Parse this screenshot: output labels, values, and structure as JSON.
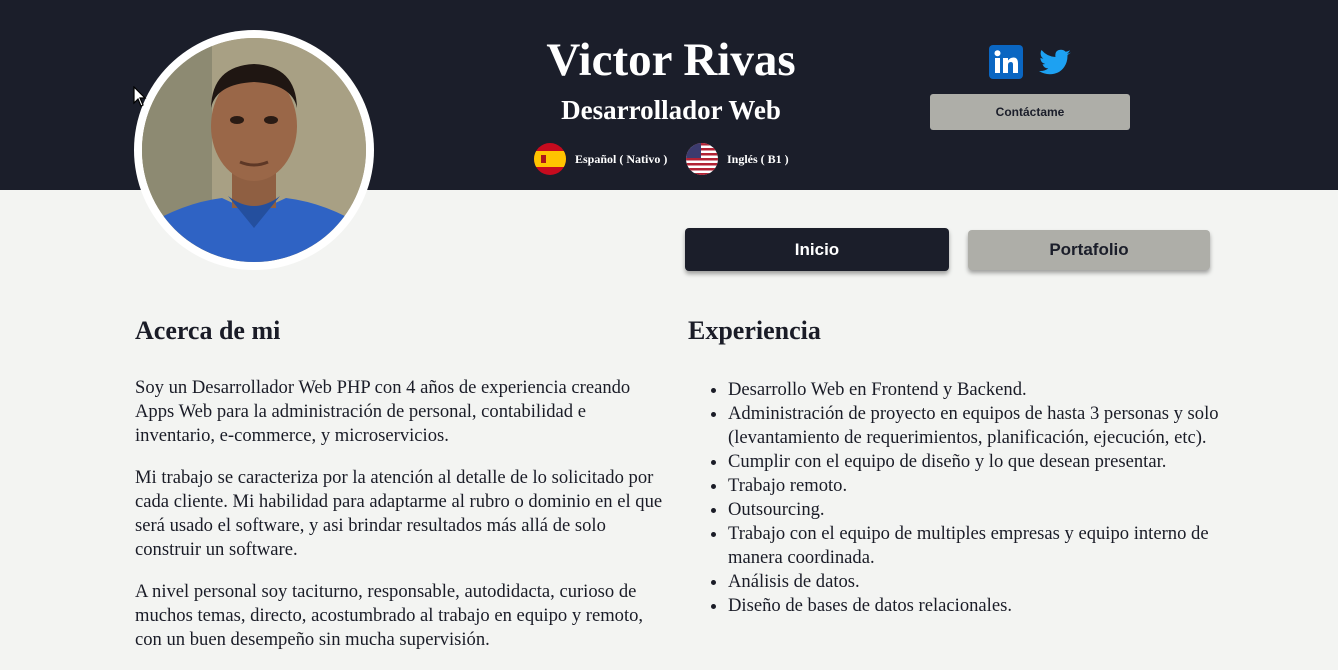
{
  "profile": {
    "name": "Victor Rivas",
    "role": "Desarrollador Web",
    "photo_icon": "profile-photo"
  },
  "languages": [
    {
      "label": "Español ( Nativo )",
      "flag": "spain-flag-icon"
    },
    {
      "label": "Inglés ( B1 )",
      "flag": "usa-flag-icon"
    }
  ],
  "social": [
    {
      "name": "linkedin-icon",
      "color": "#0a66c2",
      "text": "in"
    },
    {
      "name": "twitter-icon",
      "color": "#1da1f2"
    }
  ],
  "contact_label": "Contáctame",
  "tabs": [
    {
      "label": "Inicio",
      "active": true
    },
    {
      "label": "Portafolio",
      "active": false
    }
  ],
  "about": {
    "title": "Acerca de mi",
    "paragraphs": [
      "Soy un Desarrollador Web PHP con 4 años de experiencia creando Apps Web para la administración de personal, contabilidad e inventario, e-commerce, y microservicios.",
      "Mi trabajo se caracteriza por la atención al detalle de lo solicitado por cada cliente. Mi habilidad para adaptarme al rubro o dominio en el que será usado el software, y asi brindar resultados más allá de solo construir un software.",
      "A nivel personal soy taciturno, responsable, autodidacta, curioso de muchos temas, directo, acostumbrado al trabajo en equipo y remoto, con un buen desempeño sin mucha supervisión."
    ]
  },
  "experience": {
    "title": "Experiencia",
    "items": [
      "Desarrollo Web en Frontend y Backend.",
      "Administración de proyecto en equipos de hasta 3 personas y solo (levantamiento de requerimientos, planificación, ejecución, etc).",
      "Cumplir con el equipo de diseño y lo que desean presentar.",
      "Trabajo remoto.",
      "Outsourcing.",
      "Trabajo con el equipo de multiples empresas y equipo interno de manera coordinada.",
      "Análisis de datos.",
      "Diseño de bases de datos relacionales."
    ]
  },
  "colors": {
    "header_bg": "#1b1e2a",
    "page_bg": "#f3f4f2",
    "secondary_button": "#aeaea8"
  }
}
